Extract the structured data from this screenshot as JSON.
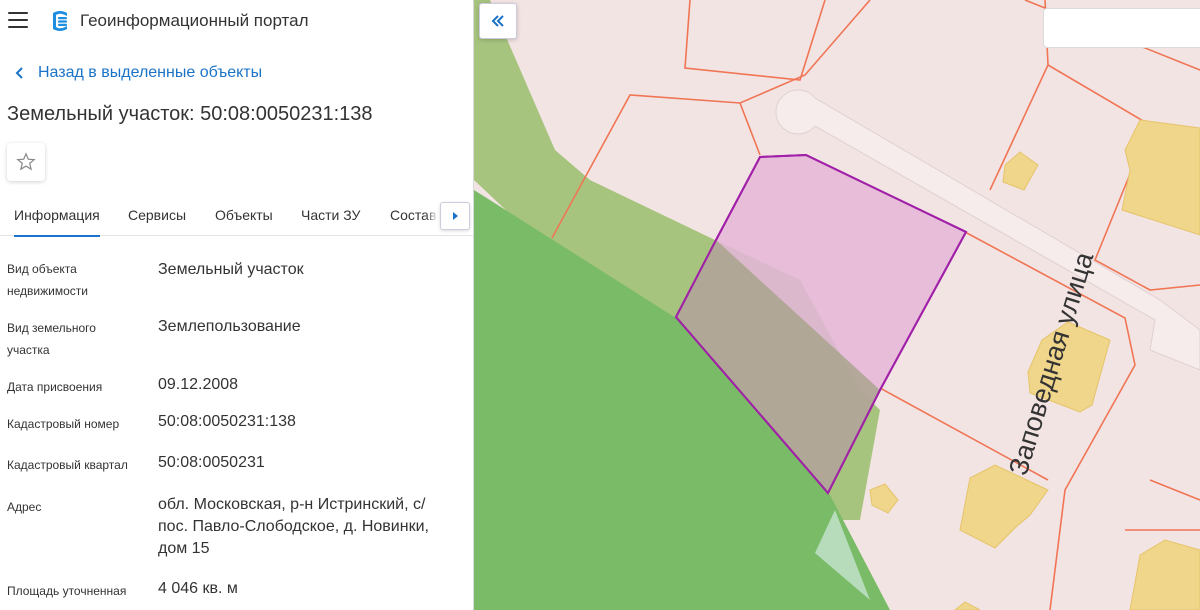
{
  "header": {
    "app_title": "Геоинформационный портал"
  },
  "navigation": {
    "back_label": "Назад в выделенные объекты"
  },
  "object": {
    "title": "Земельный участок: 50:08:0050231:138"
  },
  "tabs": [
    {
      "label": "Информация",
      "active": true
    },
    {
      "label": "Сервисы",
      "active": false
    },
    {
      "label": "Объекты",
      "active": false
    },
    {
      "label": "Части ЗУ",
      "active": false
    },
    {
      "label": "Состав",
      "active": false
    }
  ],
  "attributes": [
    {
      "label": "Вид объекта недвижимости",
      "value": "Земельный участок"
    },
    {
      "label": "Вид земельного участка",
      "value": "Землепользование"
    },
    {
      "label": "Дата присвоения",
      "value": "09.12.2008"
    },
    {
      "label": "Кадастровый номер",
      "value": "50:08:0050231:138"
    },
    {
      "label": "Кадастровый квартал",
      "value": "50:08:0050231"
    },
    {
      "label": "Адрес",
      "value": "обл. Московская, р-н Истринский, с/пос. Павло-Слободское, д. Новинки, дом 15"
    },
    {
      "label": "Площадь уточненная",
      "value": "4 046 кв. м"
    }
  ],
  "map": {
    "street_label": "Заповедная улица",
    "search_placeholder": ""
  },
  "icons": {
    "menu": "hamburger-menu-icon",
    "logo": "portal-logo-icon",
    "back": "chevron-left-icon",
    "favorite": "star-outline-icon",
    "tabs_next": "caret-right-icon",
    "collapse": "double-chevron-left-icon"
  },
  "colors": {
    "accent": "#1a73c8",
    "selected_parcel_fill": "#e4b6d8",
    "selected_parcel_stroke": "#a020a8",
    "parcel_boundary": "#f07555",
    "forest": "#79bb66",
    "building": "#f0d68a",
    "parcel_bg": "#f3e4e4"
  }
}
